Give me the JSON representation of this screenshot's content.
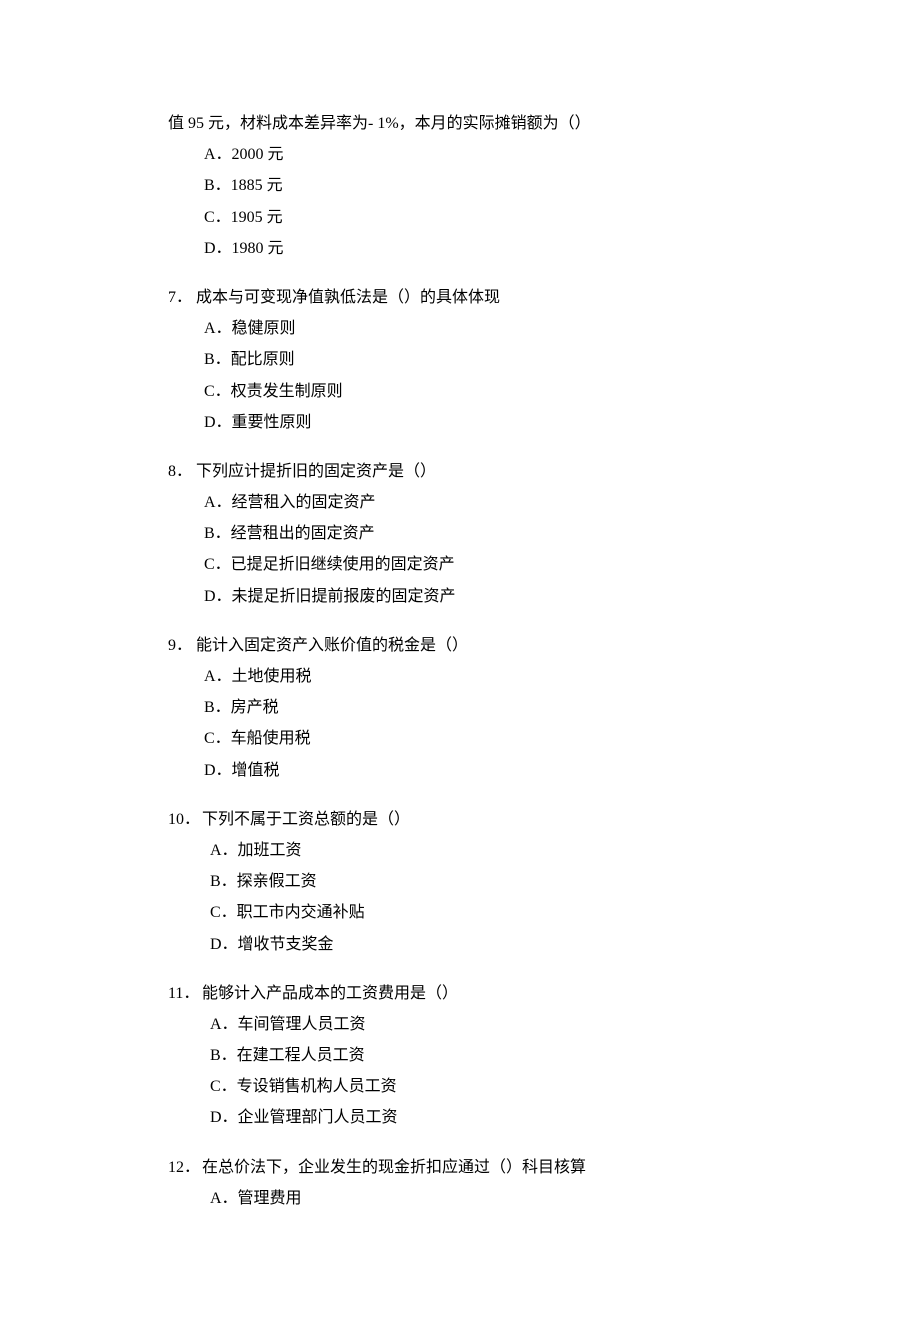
{
  "q6_continuation": "值 95 元，材料成本差异率为- 1%，本月的实际摊销额为（）",
  "q6": {
    "a": "A．2000 元",
    "b": "B．1885 元",
    "c": "C．1905 元",
    "d": "D．1980 元"
  },
  "q7": {
    "num": "7．",
    "text": "成本与可变现净值孰低法是（）的具体体现",
    "a": "A．稳健原则",
    "b": "B．配比原则",
    "c": "C．权责发生制原则",
    "d": "D．重要性原则"
  },
  "q8": {
    "num": "8．",
    "text": "下列应计提折旧的固定资产是（）",
    "a": "A．经营租入的固定资产",
    "b": "B．经营租出的固定资产",
    "c": "C．已提足折旧继续使用的固定资产",
    "d": "D．未提足折旧提前报废的固定资产"
  },
  "q9": {
    "num": "9．",
    "text": "能计入固定资产入账价值的税金是（）",
    "a": "A．土地使用税",
    "b": "B．房产税",
    "c": "C．车船使用税",
    "d": "D．增值税"
  },
  "q10": {
    "num": "10．",
    "text": "下列不属于工资总额的是（）",
    "a": "A．加班工资",
    "b": "B．探亲假工资",
    "c": "C．职工市内交通补贴",
    "d": "D．增收节支奖金"
  },
  "q11": {
    "num": "11．",
    "text": "能够计入产品成本的工资费用是（）",
    "a": "A．车间管理人员工资",
    "b": "B．在建工程人员工资",
    "c": "C．专设销售机构人员工资",
    "d": "D．企业管理部门人员工资"
  },
  "q12": {
    "num": "12．",
    "text": "在总价法下，企业发生的现金折扣应通过（）科目核算",
    "a": "A．管理费用"
  }
}
